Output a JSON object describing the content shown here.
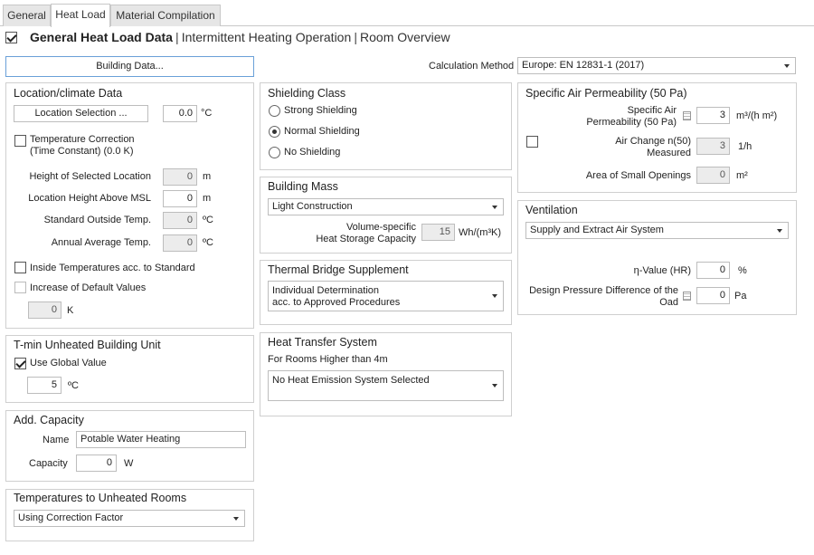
{
  "tabs": [
    {
      "label": "General",
      "active": false
    },
    {
      "label": "Heat Load",
      "active": true
    },
    {
      "label": "Material Compilation",
      "active": false
    }
  ],
  "header": {
    "checked": true,
    "title": "General Heat Load Data",
    "sep": "|",
    "link1": "Intermittent Heating Operation",
    "link2": "Room Overview"
  },
  "building_data_button": "Building Data...",
  "calc_method": {
    "label": "Calculation Method",
    "value": "Europe: EN 12831-1 (2017)"
  },
  "location": {
    "title": "Location/climate Data",
    "select_button": "Location Selection ...",
    "temp_value": "0.0",
    "temp_unit": "°C",
    "temp_correction_line1": "Temperature Correction",
    "temp_correction_line2": "(Time Constant) (0.0 K)",
    "height_selected_label": "Height of Selected Location",
    "height_selected_value": "0",
    "height_selected_unit": "m",
    "height_msl_label": "Location Height Above MSL",
    "height_msl_value": "0",
    "height_msl_unit": "m",
    "std_outside_label": "Standard Outside Temp.",
    "std_outside_value": "0",
    "std_outside_unit": "ºC",
    "annual_avg_label": "Annual Average Temp.",
    "annual_avg_value": "0",
    "annual_avg_unit": "ºC",
    "inside_temps_label": "Inside Temperatures acc. to Standard",
    "increase_default_label": "Increase of Default Values",
    "increase_value": "0",
    "increase_unit": "K"
  },
  "tmin": {
    "title": "T-min Unheated Building Unit",
    "use_global_label": "Use Global Value",
    "value": "5",
    "unit": "ºC"
  },
  "add_capacity": {
    "title": "Add. Capacity",
    "name_label": "Name",
    "name_value": "Potable Water Heating",
    "capacity_label": "Capacity",
    "capacity_value": "0",
    "capacity_unit": "W"
  },
  "unheated_rooms": {
    "title": "Temperatures to Unheated Rooms",
    "value": "Using Correction Factor"
  },
  "shielding": {
    "title": "Shielding Class",
    "options": [
      "Strong Shielding",
      "Normal Shielding",
      "No Shielding"
    ],
    "selected": "Normal Shielding"
  },
  "building_mass": {
    "title": "Building Mass",
    "value": "Light Construction",
    "heat_storage_label_line1": "Volume-specific",
    "heat_storage_label_line2": "Heat Storage Capacity",
    "heat_storage_value": "15",
    "heat_storage_unit": "Wh/(m³K)"
  },
  "thermal_bridge": {
    "title": "Thermal Bridge Supplement",
    "value_line1": "Individual Determination",
    "value_line2": "acc. to Approved Procedures"
  },
  "heat_transfer": {
    "title": "Heat Transfer System",
    "subtitle": "For Rooms Higher than 4m",
    "value": "No Heat Emission System Selected"
  },
  "air_perm": {
    "title": "Specific Air Permeability (50 Pa)",
    "spec_label_line1": "Specific Air",
    "spec_label_line2": "Permeability (50 Pa)",
    "spec_value": "3",
    "spec_unit": "m³/(h m²)",
    "air_change_line1": "Air Change n(50)",
    "air_change_line2": "Measured",
    "air_change_value": "3",
    "air_change_unit": "1/h",
    "small_openings_label": "Area of Small Openings",
    "small_openings_value": "0",
    "small_openings_unit": "m²"
  },
  "ventilation": {
    "title": "Ventilation",
    "value": "Supply and Extract Air System",
    "eta_label": "η-Value (HR)",
    "eta_value": "0",
    "eta_unit": "%",
    "pressure_line1": "Design Pressure Difference of the",
    "pressure_line2": "Oad",
    "pressure_value": "0",
    "pressure_unit": "Pa"
  }
}
